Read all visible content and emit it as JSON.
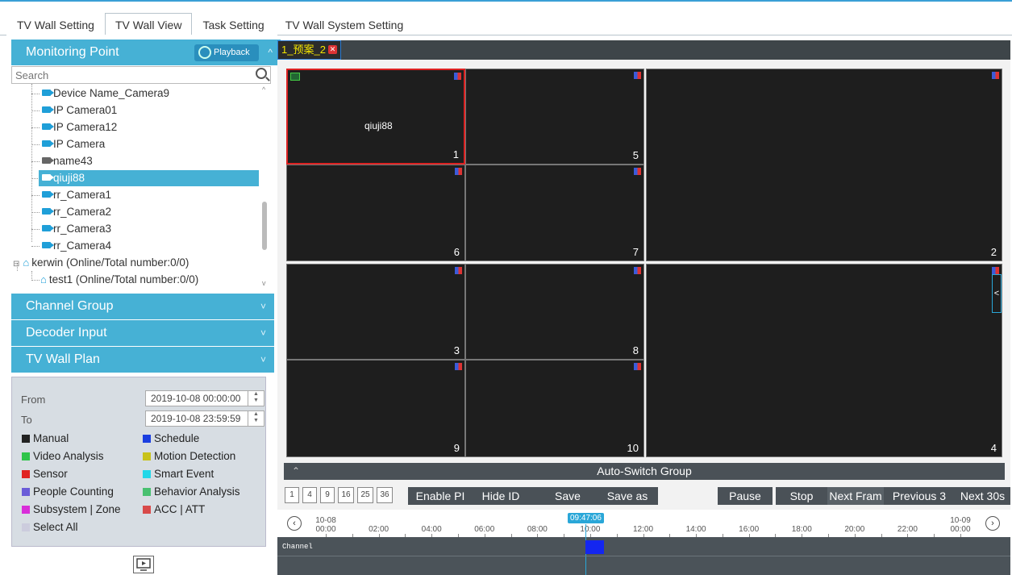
{
  "top_tabs": [
    "TV Wall Setting",
    "TV Wall View",
    "Task Setting",
    "TV Wall System Setting"
  ],
  "active_tab": "TV Wall View",
  "left": {
    "monitoring_point": "Monitoring Point",
    "playback": "Playback",
    "search_placeholder": "Search",
    "tree": [
      {
        "label": "Device Name_Camera9",
        "icon": "camera-icon"
      },
      {
        "label": "IP Camera01",
        "icon": "camera-icon"
      },
      {
        "label": "IP Camera12",
        "icon": "camera-icon"
      },
      {
        "label": "IP Camera",
        "icon": "camera-icon"
      },
      {
        "label": "name43",
        "icon": "camera-offline-icon"
      },
      {
        "label": "qiuji88",
        "icon": "camera-icon",
        "selected": true
      },
      {
        "label": "rr_Camera1",
        "icon": "camera-icon"
      },
      {
        "label": "rr_Camera2",
        "icon": "camera-icon"
      },
      {
        "label": "rr_Camera3",
        "icon": "camera-icon"
      },
      {
        "label": "rr_Camera4",
        "icon": "camera-icon"
      },
      {
        "label": "kerwin (Online/Total number:0/0)",
        "icon": "home-icon"
      },
      {
        "label": "test1 (Online/Total number:0/0)",
        "icon": "home-icon"
      }
    ],
    "channel_group": "Channel Group",
    "decoder_input": "Decoder Input",
    "tv_wall_plan": "TV Wall Plan"
  },
  "filter": {
    "from_label": "From",
    "to_label": "To",
    "from_value": "2019-10-08 00:00:00",
    "to_value": "2019-10-08 23:59:59",
    "checks": [
      {
        "label": "Manual",
        "color": "#222222"
      },
      {
        "label": "Schedule",
        "color": "#1a3ee0"
      },
      {
        "label": "Video Analysis",
        "color": "#2fc44a"
      },
      {
        "label": "Motion Detection",
        "color": "#c8c21a"
      },
      {
        "label": "Sensor",
        "color": "#e02222"
      },
      {
        "label": "Smart Event",
        "color": "#22d7e8"
      },
      {
        "label": "People Counting",
        "color": "#6a5cd8"
      },
      {
        "label": "Behavior Analysis",
        "color": "#48c070"
      },
      {
        "label": "Subsystem | Zone",
        "color": "#d92ed9"
      },
      {
        "label": "ACC | ATT",
        "color": "#d84a4a"
      }
    ],
    "select_all": "Select All"
  },
  "video": {
    "tab_label": "1_预案_2",
    "cells": [
      {
        "num": "1",
        "caption": "qiuji88"
      },
      {
        "num": "5",
        "caption": ""
      },
      {
        "num": "2",
        "caption": ""
      },
      {
        "num": "6",
        "caption": ""
      },
      {
        "num": "7",
        "caption": ""
      },
      {
        "num": "3",
        "caption": ""
      },
      {
        "num": "8",
        "caption": ""
      },
      {
        "num": "4",
        "caption": ""
      },
      {
        "num": "9",
        "caption": ""
      },
      {
        "num": "10",
        "caption": ""
      }
    ],
    "side_handle": "<",
    "auto_switch": "Auto-Switch Group"
  },
  "controls": {
    "layouts": [
      "1",
      "4",
      "9",
      "16",
      "25",
      "36"
    ],
    "enable_pip": "Enable PI",
    "hide_id": "Hide ID",
    "save": "Save",
    "save_as": "Save as",
    "pause": "Pause",
    "stop": "Stop",
    "next_frame": "Next Fram",
    "previous_3": "Previous 3",
    "next_30s": "Next 30s"
  },
  "timeline": {
    "start_date": "10-08",
    "start_time": "00:00",
    "end_date": "10-09",
    "end_time": "00:00",
    "hours": [
      "02:00",
      "04:00",
      "06:00",
      "08:00",
      "10:00",
      "12:00",
      "14:00",
      "16:00",
      "18:00",
      "20:00",
      "22:00"
    ],
    "current_time": "09:47:06",
    "channel_label": "Channel",
    "recording_start_hour": 9.8,
    "recording_end_hour": 10.3
  }
}
